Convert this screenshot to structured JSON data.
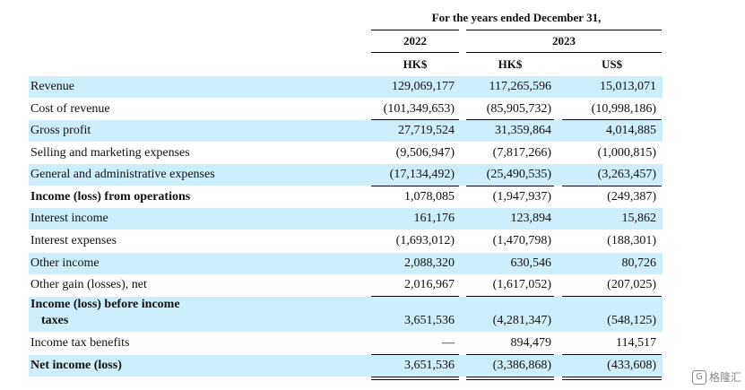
{
  "header": {
    "period": "For the years ended December 31,",
    "year_2022": "2022",
    "year_2023": "2023",
    "cur1": "HK$",
    "cur2": "HK$",
    "cur3": "US$"
  },
  "rows": [
    {
      "label": "Revenue",
      "v1": "129,069,177",
      "v2": "117,265,596",
      "v3": "15,013,071"
    },
    {
      "label": "Cost of revenue",
      "v1": "(101,349,653)",
      "v2": "(85,905,732)",
      "v3": "(10,998,186)"
    },
    {
      "label": "Gross profit",
      "v1": "27,719,524",
      "v2": "31,359,864",
      "v3": "4,014,885"
    },
    {
      "label": "Selling and marketing expenses",
      "v1": "(9,506,947)",
      "v2": "(7,817,266)",
      "v3": "(1,000,815)"
    },
    {
      "label": "General and administrative expenses",
      "v1": "(17,134,492)",
      "v2": "(25,490,535)",
      "v3": "(3,263,457)"
    },
    {
      "label": "Income (loss) from operations",
      "v1": "1,078,085",
      "v2": "(1,947,937)",
      "v3": "(249,387)"
    },
    {
      "label": "Interest income",
      "v1": "161,176",
      "v2": "123,894",
      "v3": "15,862"
    },
    {
      "label": "Interest expenses",
      "v1": "(1,693,012)",
      "v2": "(1,470,798)",
      "v3": "(188,301)"
    },
    {
      "label": "Other income",
      "v1": "2,088,320",
      "v2": "630,546",
      "v3": "80,726"
    },
    {
      "label": "Other gain (losses), net",
      "v1": "2,016,967",
      "v2": "(1,617,052)",
      "v3": "(207,025)"
    },
    {
      "label": "Income (loss) before income",
      "label2": "taxes",
      "v1": "3,651,536",
      "v2": "(4,281,347)",
      "v3": "(548,125)"
    },
    {
      "label": "Income tax benefits",
      "v1": "—",
      "v2": "894,479",
      "v3": "114,517"
    },
    {
      "label": "Net income (loss)",
      "v1": "3,651,536",
      "v2": "(3,386,868)",
      "v3": "(433,608)"
    }
  ],
  "watermark": "格隆汇",
  "watermark_icon": "g-logo-icon"
}
